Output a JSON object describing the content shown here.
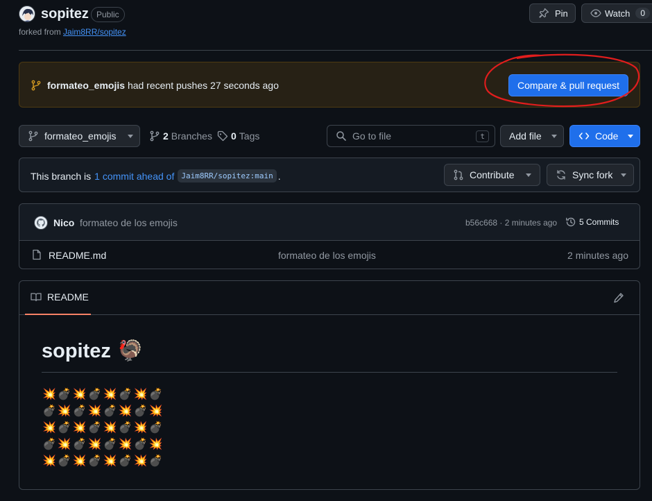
{
  "repo": {
    "name": "sopitez",
    "visibility": "Public",
    "fork_prefix": "forked from",
    "fork_source": "Jaim8RR/sopitez"
  },
  "header_actions": {
    "pin_label": "Pin",
    "watch_label": "Watch",
    "watch_count": "0"
  },
  "push_banner": {
    "branch": "formateo_emojis",
    "message": "had recent pushes 27 seconds ago",
    "button_label": "Compare & pull request",
    "annotation_color": "#e11d1d"
  },
  "toolbar": {
    "branch_select": "formateo_emojis",
    "branches_count": "2",
    "branches_label": "Branches",
    "tags_count": "0",
    "tags_label": "Tags",
    "goto_placeholder": "Go to file",
    "goto_shortcut": "t",
    "add_file_label": "Add file",
    "code_label": "Code"
  },
  "branch_status": {
    "prefix": "This branch is",
    "ahead_link": "1 commit ahead of",
    "ref": "Jaim8RR/sopitez:main",
    "suffix": ".",
    "contribute_label": "Contribute",
    "sync_label": "Sync fork"
  },
  "latest_commit": {
    "author": "Nico",
    "message": "formateo de los emojis",
    "meta": "b56c668 · 2 minutes ago",
    "commits_label": "5 Commits"
  },
  "files": [
    {
      "name": "README.md",
      "commit_message": "formateo de los emojis",
      "time": "2 minutes ago"
    }
  ],
  "readme": {
    "tab_label": "README",
    "heading": "sopitez",
    "heading_emoji": "🦃",
    "emoji_rows": [
      "💥💣💥💣💥💣💥💣",
      "💣💥💣💥💣💥💣💥",
      "💥💣💥💣💥💣💥💣",
      "💣💥💣💥💣💥💣💥",
      "💥💣💥💣💥💣💥💣"
    ]
  },
  "colors": {
    "background": "#0d1117",
    "accent": "#1f6feb",
    "link": "#4493f8",
    "banner_bg": "#272115",
    "banner_border": "#4d3a12",
    "readme_tab_underline": "#f78166"
  }
}
